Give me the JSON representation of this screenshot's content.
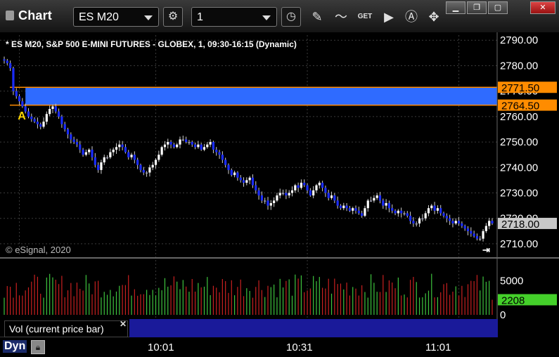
{
  "window": {
    "title": "Chart",
    "symbol": "ES M20",
    "interval": "1",
    "minimize_icon": "minimize-icon",
    "restore_icon": "restore-icon",
    "maximize_icon": "maximize-icon",
    "close_icon": "close-icon"
  },
  "toolbar": {
    "icons": [
      "settings-gear-icon",
      "clock-icon",
      "pencil-draw-icon",
      "study-icon",
      "get-data-icon",
      "play-icon",
      "alert-icon",
      "hand-tool-icon"
    ]
  },
  "chart_data": [
    {
      "type": "candlestick",
      "title": "* ES M20, S&P 500 E-MINI FUTURES - GLOBEX, 1, 09:30-16:15 (Dynamic)",
      "watermark": "© eSignal, 2020",
      "ylim": [
        2705,
        2792
      ],
      "yticks": [
        2790,
        2780,
        2770,
        2760,
        2750,
        2740,
        2730,
        2720,
        2710
      ],
      "ytick_labels": [
        "2790.00",
        "2780.00",
        "2770.00",
        "2760.00",
        "2750.00",
        "2740.00",
        "2730.00",
        "2720.00",
        "2710.00"
      ],
      "xticks": [
        {
          "index": 50,
          "label": "10:01"
        },
        {
          "index": 100,
          "label": "10:31"
        },
        {
          "index": 150,
          "label": "11:01"
        }
      ],
      "grid": true,
      "price_levels": [
        {
          "value": 2771.5,
          "label": "2771.50",
          "color": "#ff8c00"
        },
        {
          "value": 2764.5,
          "label": "2764.50",
          "color": "#ff8c00"
        }
      ],
      "zone": {
        "from": 2764.5,
        "to": 2771.5,
        "color": "#2f6bff",
        "start_index": 7
      },
      "current_price": {
        "value": 2718.0,
        "label": "2718.00"
      },
      "annotation": {
        "text": "A",
        "index": 4,
        "value": 2760.5,
        "color": "#ffd700"
      },
      "closes": [
        2782,
        2781,
        2779,
        2770,
        2768,
        2766,
        2764,
        2762,
        2760,
        2759,
        2758,
        2757,
        2756,
        2758,
        2761,
        2763,
        2764,
        2762,
        2760,
        2757,
        2755,
        2753,
        2751,
        2750,
        2749,
        2747,
        2745,
        2746,
        2747,
        2744,
        2741,
        2739,
        2742,
        2744,
        2744,
        2746,
        2747,
        2748,
        2749,
        2748,
        2746,
        2744,
        2745,
        2743,
        2741,
        2739,
        2738,
        2738,
        2740,
        2741,
        2743,
        2745,
        2748,
        2749,
        2750,
        2749,
        2748,
        2749,
        2751,
        2751,
        2750,
        2750,
        2749,
        2748,
        2749,
        2747,
        2748,
        2749,
        2750,
        2747,
        2746,
        2745,
        2743,
        2741,
        2739,
        2737,
        2738,
        2736,
        2735,
        2734,
        2735,
        2736,
        2733,
        2731,
        2729,
        2727,
        2727,
        2725,
        2726,
        2727,
        2729,
        2730,
        2730,
        2729,
        2730,
        2731,
        2733,
        2732,
        2734,
        2733,
        2731,
        2729,
        2731,
        2733,
        2734,
        2732,
        2730,
        2728,
        2729,
        2727,
        2725,
        2724,
        2725,
        2724,
        2723,
        2724,
        2723,
        2722,
        2721,
        2724,
        2727,
        2727,
        2728,
        2729,
        2727,
        2725,
        2726,
        2724,
        2723,
        2722,
        2723,
        2722,
        2722,
        2721,
        2719,
        2718,
        2718,
        2720,
        2720,
        2722,
        2724,
        2725,
        2723,
        2724,
        2722,
        2721,
        2720,
        2719,
        2718,
        2719,
        2718,
        2717,
        2716,
        2715,
        2714,
        2713,
        2712,
        2712,
        2715,
        2717,
        2719,
        2718
      ],
      "volume": {
        "label": "Vol (current price bar)",
        "current": 2208,
        "current_label": "2208",
        "ylim": [
          0,
          7800
        ],
        "yticks": [
          5000,
          0
        ],
        "ytick_labels": [
          "5000",
          "0"
        ]
      }
    }
  ],
  "status": {
    "mode": "Dyn",
    "lock_icon": "lock-icon",
    "scroll_end_icon": "scroll-to-end-icon"
  }
}
